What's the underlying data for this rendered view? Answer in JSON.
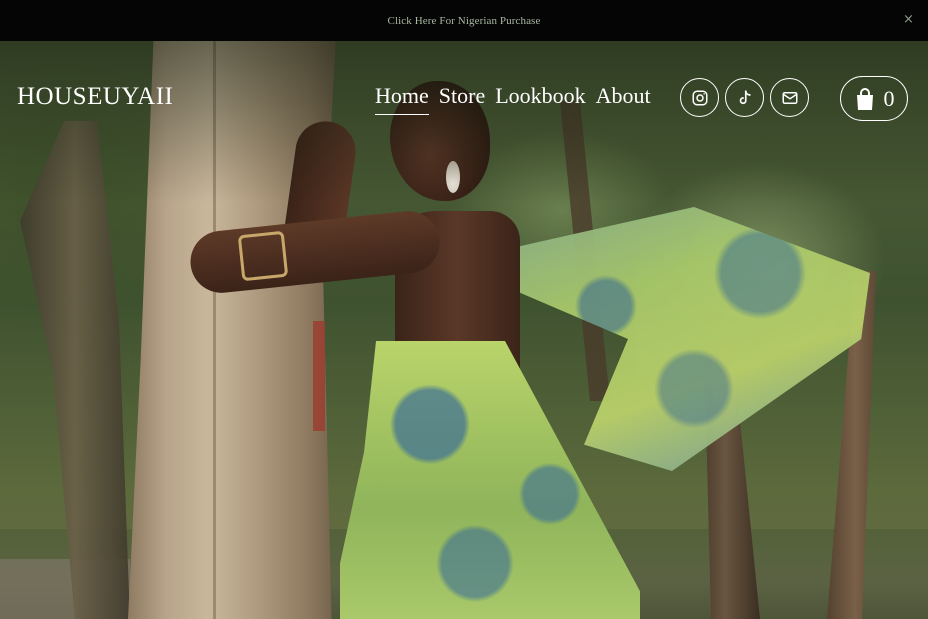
{
  "announcement": {
    "text": "Click Here For Nigerian Purchase",
    "close_glyph": "×"
  },
  "header": {
    "logo": "HOUSEUYAII",
    "nav": [
      {
        "label": "Home",
        "active": true
      },
      {
        "label": "Store",
        "active": false
      },
      {
        "label": "Lookbook",
        "active": false
      },
      {
        "label": "About",
        "active": false
      }
    ],
    "social_icons": [
      "instagram-icon",
      "tiktok-icon",
      "email-icon"
    ],
    "cart": {
      "icon": "shopping-bag-icon",
      "count": "0"
    }
  },
  "colors": {
    "announcement_bg": "#050505",
    "announcement_text": "#a9b8a0",
    "header_text": "#ffffff"
  }
}
